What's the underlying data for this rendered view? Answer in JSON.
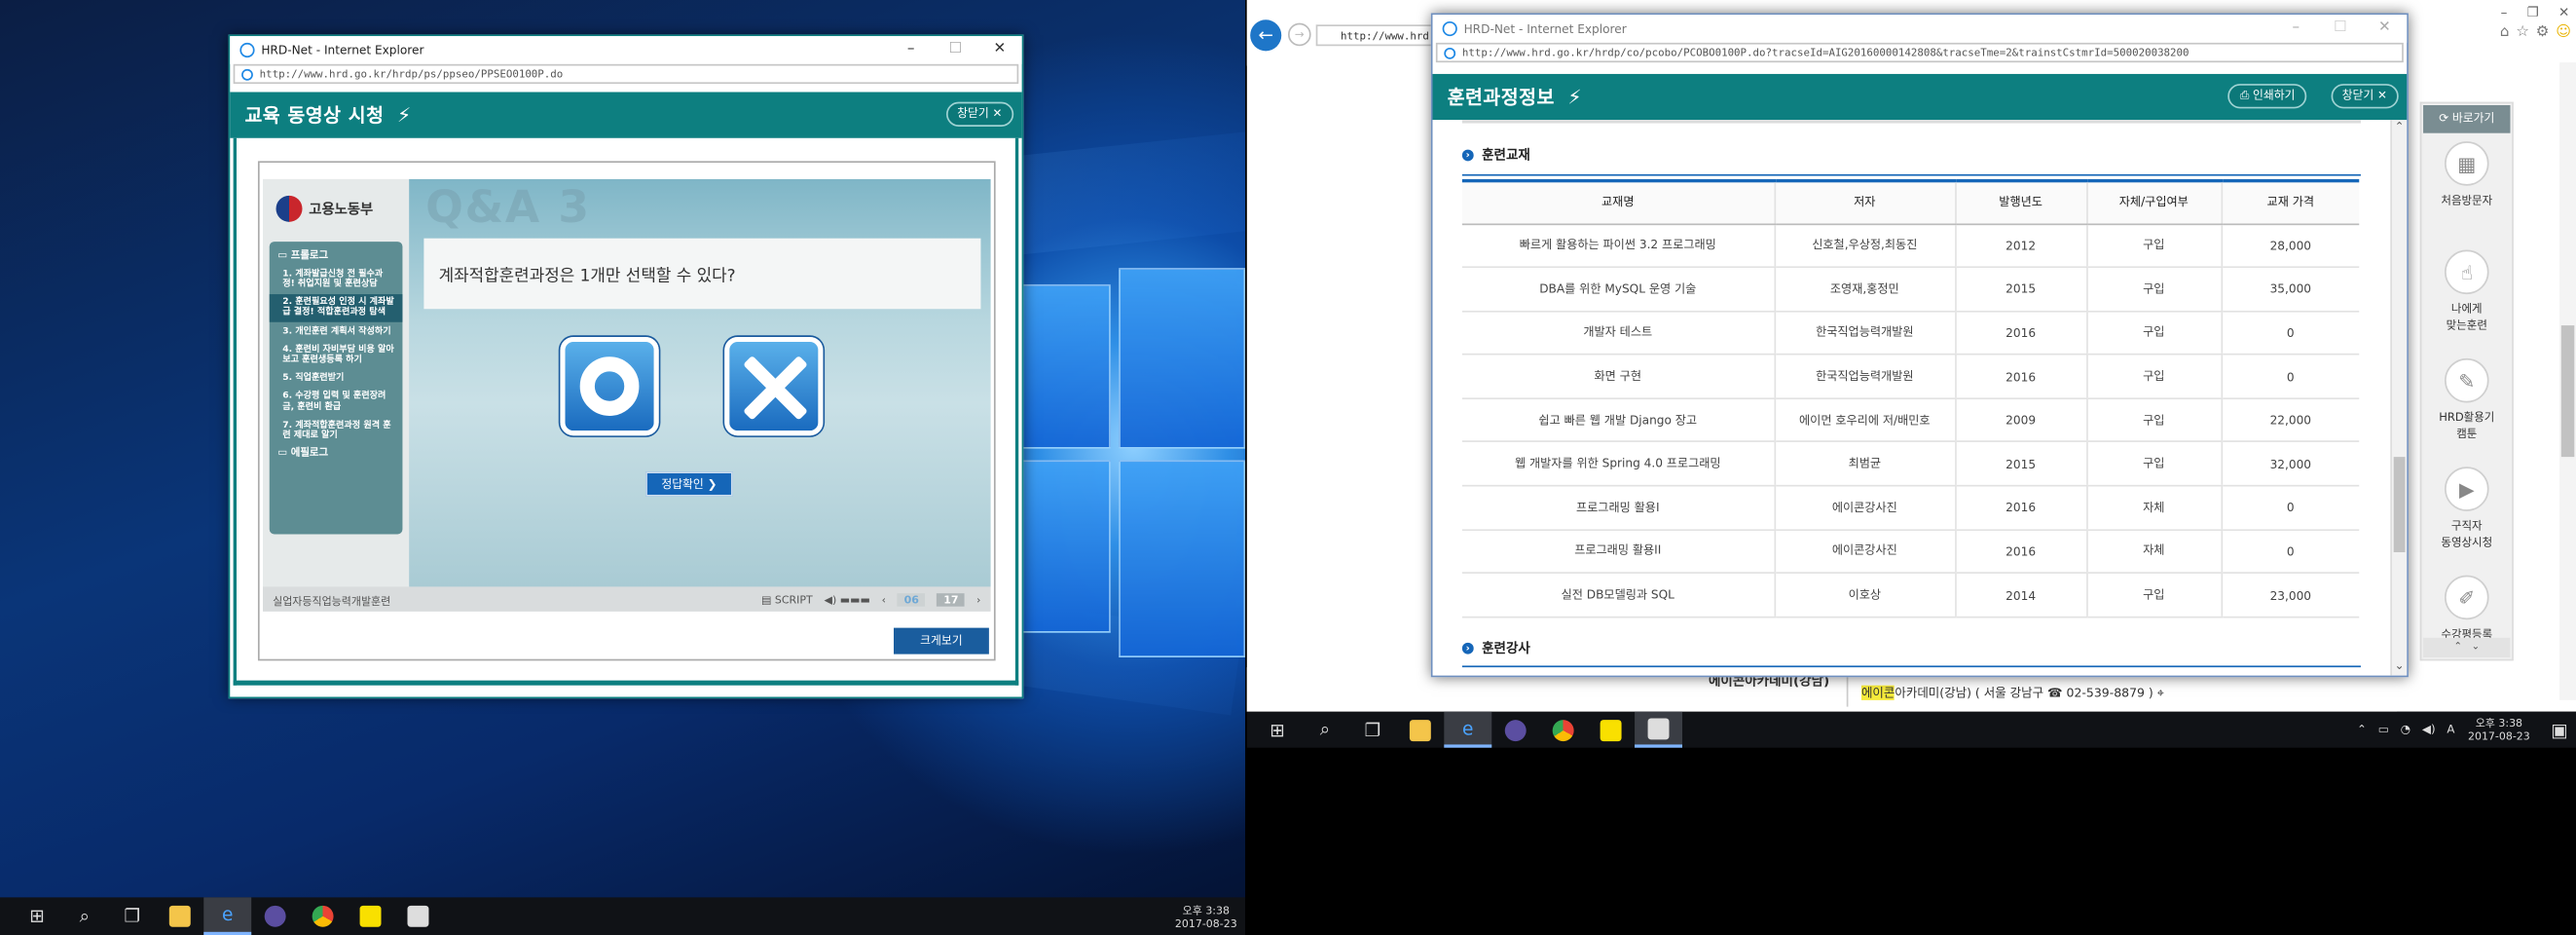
{
  "left_window": {
    "title": "HRD-Net - Internet Explorer",
    "url": "http://www.hrd.go.kr/hrdp/ps/ppseo/PPSEO0100P.do",
    "header_title": "교육 동영상 시청",
    "close_label": "창닫기",
    "player": {
      "logo_text": "고용노동부",
      "menu_items": [
        "프롤로그",
        "1. 계좌발급신청 전 필수과정! 취업지원 및 훈련상담",
        "2. 훈련필요성 인정 시 계좌발급 결정! 적합훈련과정 탐색",
        "3. 개인훈련 계획서 작성하기",
        "4. 훈련비 자비부담 비용 알아보고 훈련생등록 하기",
        "5. 직업훈련받기",
        "6. 수강평 입력 및 훈련장려금, 훈련비 환급",
        "7. 계좌적합훈련과정 원격 훈련 제대로 알기",
        "에필로그"
      ],
      "stage_heading": "Q&A 3",
      "question": "계좌적합훈련과정은 1개만 선택할 수 있다?",
      "answer_button": "정답확인",
      "answer_arrow": "❯",
      "course_name": "실업자등직업능력개발훈련",
      "script_label": "SCRIPT",
      "current_page": "06",
      "total_pages": "17"
    },
    "big_button": "크게보기"
  },
  "right_window": {
    "title": "HRD-Net - Internet Explorer",
    "url": "http://www.hrd.go.kr/hrdp/co/pcobo/PCOBO0100P.do?tracseId=AIG20160000142808&tracseTme=2&trainstCstmrId=500020038200",
    "header_title": "훈련과정정보",
    "print_label": "인쇄하기",
    "close_label": "창닫기",
    "section_books": "훈련교재",
    "section_teachers": "훈련강사",
    "table": {
      "headers": [
        "교재명",
        "저자",
        "발행년도",
        "자체/구입여부",
        "교재 가격"
      ],
      "rows": [
        [
          "빠르게 활용하는 파이썬 3.2 프로그래밍",
          "신호철,우상정,최동진",
          "2012",
          "구입",
          "28,000"
        ],
        [
          "DBA를 위한 MySQL 운영 기술",
          "조영재,홍정민",
          "2015",
          "구입",
          "35,000"
        ],
        [
          "개발자 테스트",
          "한국직업능력개발원",
          "2016",
          "구입",
          "0"
        ],
        [
          "화면 구현",
          "한국직업능력개발원",
          "2016",
          "구입",
          "0"
        ],
        [
          "쉽고 빠른 웹 개발 Django 장고",
          "에이먼 호우리에 저/배민호",
          "2009",
          "구입",
          "22,000"
        ],
        [
          "웹 개발자를 위한 Spring 4.0 프로그래밍",
          "최범균",
          "2015",
          "구입",
          "32,000"
        ],
        [
          "프로그래밍 활용I",
          "에이콘강사진",
          "2016",
          "자체",
          "0"
        ],
        [
          "프로그래밍 활용II",
          "에이콘강사진",
          "2016",
          "자체",
          "0"
        ],
        [
          "실전 DB모델링과 SQL",
          "이호상",
          "2014",
          "구입",
          "23,000"
        ]
      ]
    }
  },
  "right_browser": {
    "url_fragment": "http://www.hrd.g",
    "quick_menu": {
      "title": "바로가기",
      "items": [
        "처음방문자",
        "나에게\n맞는훈련",
        "HRD활용기\n캠툰",
        "구직자\n동영상시청",
        "수강평등록"
      ]
    },
    "bottom_academy": "에이콘아카데미(강남)",
    "bottom_line_hl": "에이콘",
    "bottom_line": "아카데미(강남)  ( 서울 강남구 ☎ 02-539-8879 )"
  },
  "left_taskbar": {
    "time": "오후 3:38",
    "date": "2017-08-23"
  },
  "right_taskbar": {
    "time": "오후 3:38",
    "date": "2017-08-23",
    "ime": "A"
  }
}
